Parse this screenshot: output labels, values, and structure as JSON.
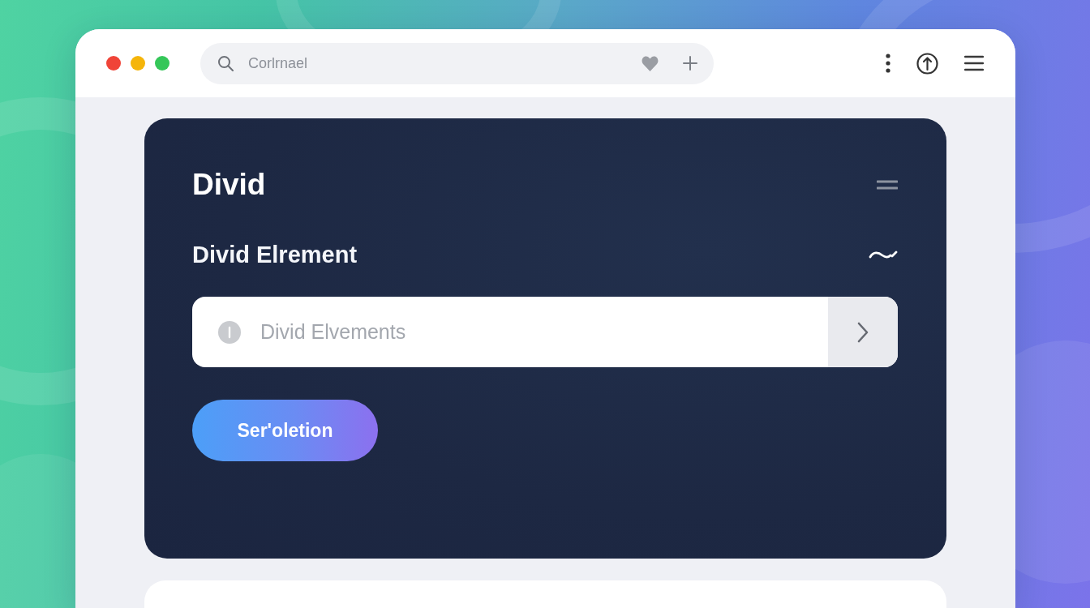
{
  "window_controls": [
    {
      "color": "#f04438"
    },
    {
      "color": "#f5b50a"
    },
    {
      "color": "#35c759"
    }
  ],
  "address_bar": {
    "placeholder": "Corlrnael"
  },
  "card": {
    "title": "Divid",
    "subtitle": "Divid Elrement",
    "input": {
      "placeholder": "Divid Elvements"
    },
    "button": "Ser'oletion"
  }
}
